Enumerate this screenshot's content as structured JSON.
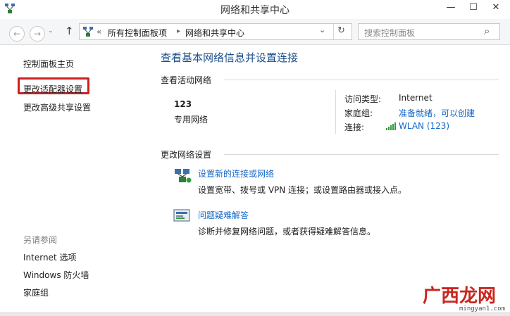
{
  "window": {
    "title": "网络和共享中心",
    "minimize_glyph": "—",
    "maximize_glyph": "☐",
    "close_glyph": "✕"
  },
  "nav": {
    "back_glyph": "←",
    "forward_glyph": "→",
    "up_glyph": "↑",
    "breadcrumb_sep": "«",
    "breadcrumb": [
      "所有控制面板项",
      "网络和共享中心"
    ],
    "crumb_arrow": "▸",
    "dropdown_glyph": "⌄",
    "refresh_glyph": "↻",
    "search_placeholder": "搜索控制面板",
    "search_glyph": "⌕"
  },
  "sidebar": {
    "items": [
      {
        "label": "控制面板主页"
      },
      {
        "label": "更改适配器设置",
        "highlighted": true
      },
      {
        "label": "更改高级共享设置"
      }
    ],
    "see_also_title": "另请参阅",
    "see_also": [
      {
        "label": "Internet 选项"
      },
      {
        "label": "Windows 防火墙"
      },
      {
        "label": "家庭组"
      }
    ]
  },
  "main": {
    "heading": "查看基本网络信息并设置连接",
    "active_networks_title": "查看活动网络",
    "network": {
      "name": "123",
      "type": "专用网络",
      "access_type_label": "访问类型:",
      "access_type_value": "Internet",
      "homegroup_label": "家庭组:",
      "homegroup_value": "准备就绪，可以创建",
      "connection_label": "连接:",
      "connection_value": "WLAN (123)"
    },
    "change_settings_title": "更改网络设置",
    "tasks": [
      {
        "title": "设置新的连接或网络",
        "description": "设置宽带、拨号或 VPN 连接；或设置路由器或接入点。",
        "icon": "network-setup-icon"
      },
      {
        "title": "问题疑难解答",
        "description": "诊断并修复网络问题，或者获得疑难解答信息。",
        "icon": "troubleshoot-icon"
      }
    ]
  },
  "watermark": {
    "cn": "广西龙网",
    "en": "mingyan1.com"
  },
  "colors": {
    "link": "#1467c8",
    "heading": "#1a4e8a",
    "highlight": "#cc1f1f",
    "signal": "#2e9d3a"
  }
}
